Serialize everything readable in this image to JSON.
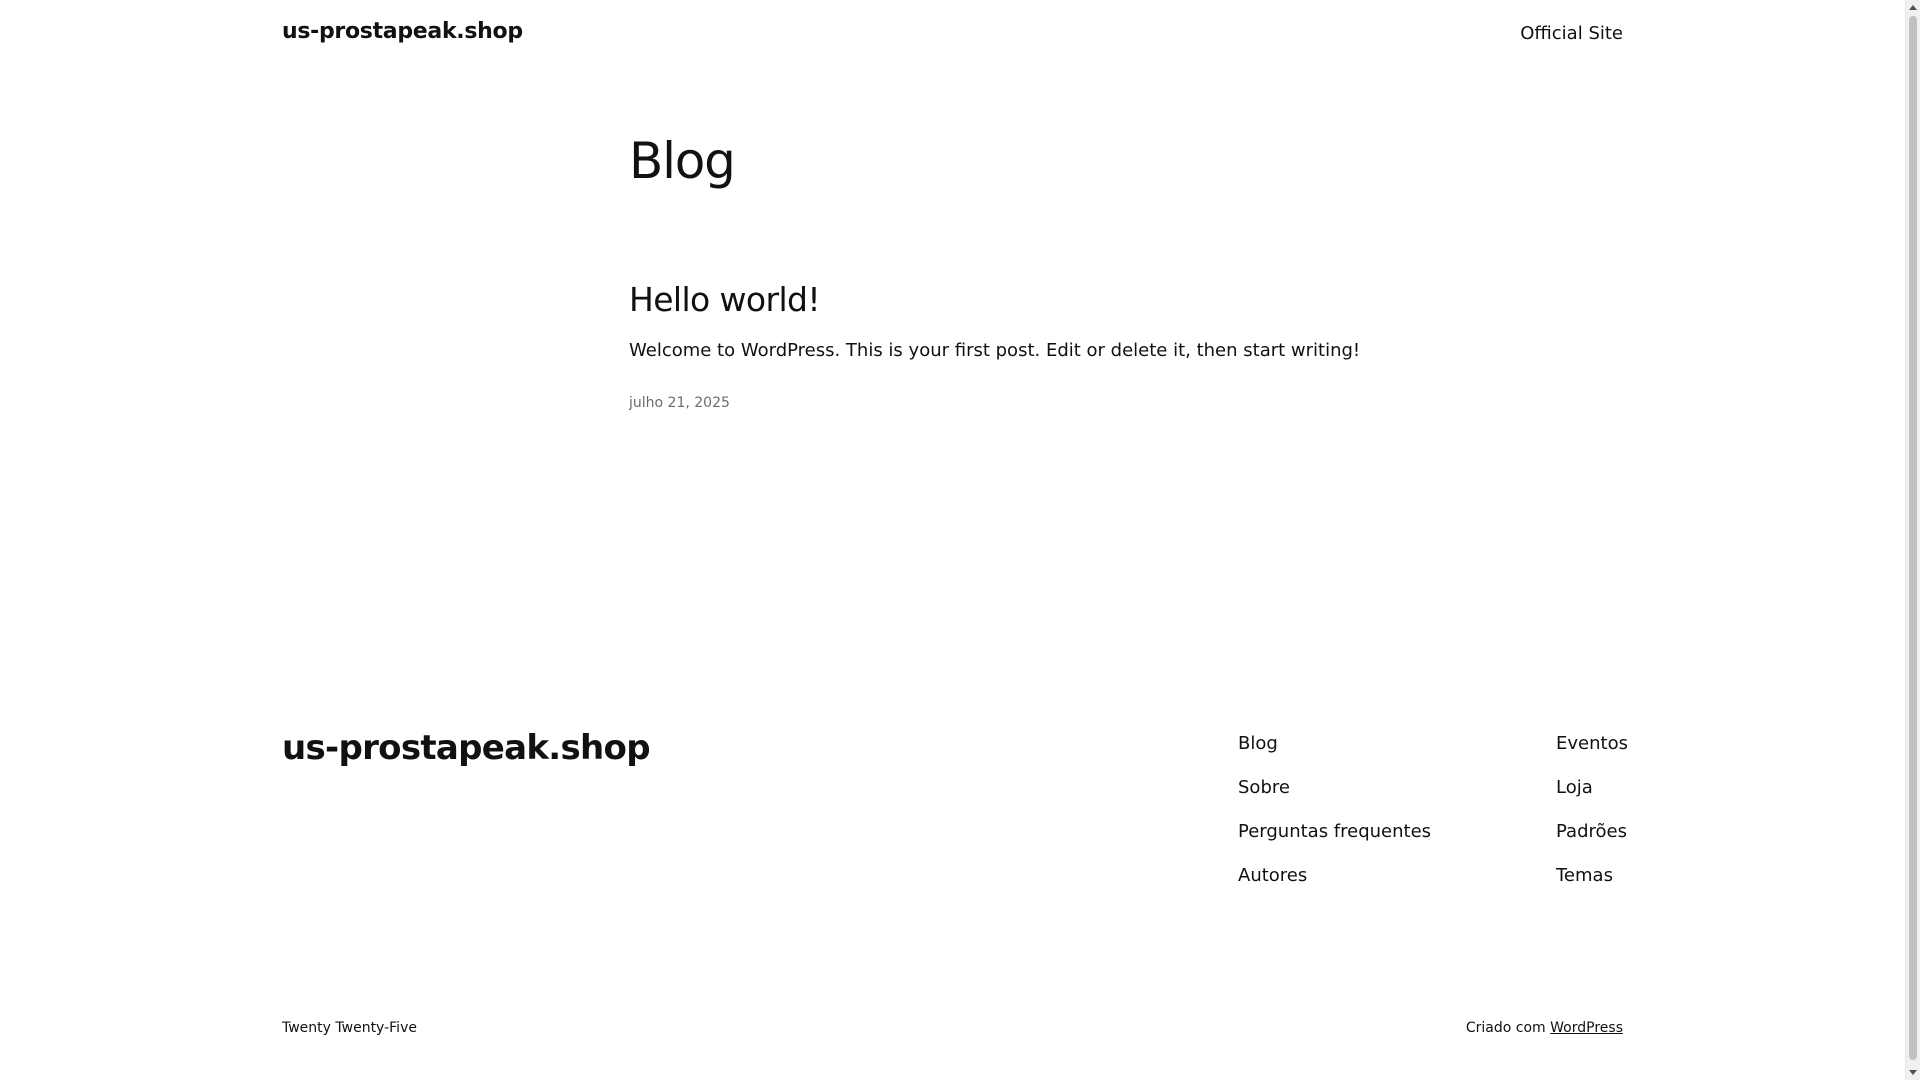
{
  "header": {
    "site_title": "us-prostapeak.shop",
    "nav_link": "Official Site"
  },
  "main": {
    "page_heading": "Blog",
    "posts": [
      {
        "title": "Hello world!",
        "excerpt": "Welcome to WordPress. This is your first post. Edit or delete it, then start writing!",
        "date": "julho 21, 2025"
      }
    ]
  },
  "footer": {
    "site_title": "us-prostapeak.shop",
    "nav_col1": [
      "Blog",
      "Sobre",
      "Perguntas frequentes",
      "Autores"
    ],
    "nav_col2": [
      "Eventos",
      "Loja",
      "Padrões",
      "Temas"
    ],
    "theme_credit": "Twenty Twenty-Five",
    "made_with_prefix": "Criado com",
    "made_with_link": "WordPress"
  },
  "colors": {
    "background": "#ffffff",
    "text": "#111111",
    "meta_text": "#6b6b6b"
  }
}
